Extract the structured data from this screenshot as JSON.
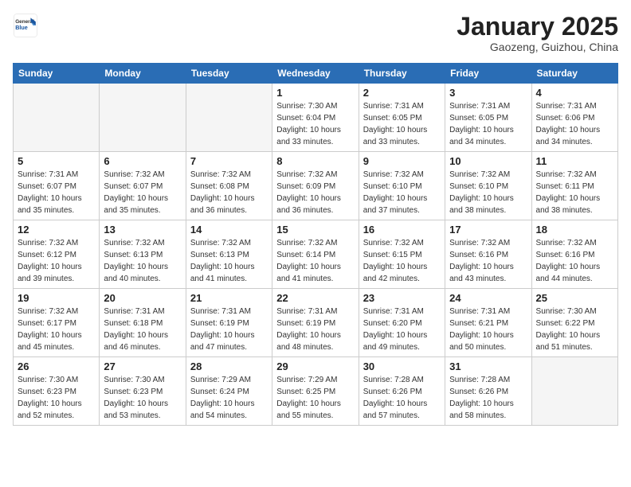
{
  "header": {
    "logo_general": "General",
    "logo_blue": "Blue",
    "month": "January 2025",
    "location": "Gaozeng, Guizhou, China"
  },
  "days_of_week": [
    "Sunday",
    "Monday",
    "Tuesday",
    "Wednesday",
    "Thursday",
    "Friday",
    "Saturday"
  ],
  "weeks": [
    [
      {
        "day": "",
        "info": ""
      },
      {
        "day": "",
        "info": ""
      },
      {
        "day": "",
        "info": ""
      },
      {
        "day": "1",
        "info": "Sunrise: 7:30 AM\nSunset: 6:04 PM\nDaylight: 10 hours\nand 33 minutes."
      },
      {
        "day": "2",
        "info": "Sunrise: 7:31 AM\nSunset: 6:05 PM\nDaylight: 10 hours\nand 33 minutes."
      },
      {
        "day": "3",
        "info": "Sunrise: 7:31 AM\nSunset: 6:05 PM\nDaylight: 10 hours\nand 34 minutes."
      },
      {
        "day": "4",
        "info": "Sunrise: 7:31 AM\nSunset: 6:06 PM\nDaylight: 10 hours\nand 34 minutes."
      }
    ],
    [
      {
        "day": "5",
        "info": "Sunrise: 7:31 AM\nSunset: 6:07 PM\nDaylight: 10 hours\nand 35 minutes."
      },
      {
        "day": "6",
        "info": "Sunrise: 7:32 AM\nSunset: 6:07 PM\nDaylight: 10 hours\nand 35 minutes."
      },
      {
        "day": "7",
        "info": "Sunrise: 7:32 AM\nSunset: 6:08 PM\nDaylight: 10 hours\nand 36 minutes."
      },
      {
        "day": "8",
        "info": "Sunrise: 7:32 AM\nSunset: 6:09 PM\nDaylight: 10 hours\nand 36 minutes."
      },
      {
        "day": "9",
        "info": "Sunrise: 7:32 AM\nSunset: 6:10 PM\nDaylight: 10 hours\nand 37 minutes."
      },
      {
        "day": "10",
        "info": "Sunrise: 7:32 AM\nSunset: 6:10 PM\nDaylight: 10 hours\nand 38 minutes."
      },
      {
        "day": "11",
        "info": "Sunrise: 7:32 AM\nSunset: 6:11 PM\nDaylight: 10 hours\nand 38 minutes."
      }
    ],
    [
      {
        "day": "12",
        "info": "Sunrise: 7:32 AM\nSunset: 6:12 PM\nDaylight: 10 hours\nand 39 minutes."
      },
      {
        "day": "13",
        "info": "Sunrise: 7:32 AM\nSunset: 6:13 PM\nDaylight: 10 hours\nand 40 minutes."
      },
      {
        "day": "14",
        "info": "Sunrise: 7:32 AM\nSunset: 6:13 PM\nDaylight: 10 hours\nand 41 minutes."
      },
      {
        "day": "15",
        "info": "Sunrise: 7:32 AM\nSunset: 6:14 PM\nDaylight: 10 hours\nand 41 minutes."
      },
      {
        "day": "16",
        "info": "Sunrise: 7:32 AM\nSunset: 6:15 PM\nDaylight: 10 hours\nand 42 minutes."
      },
      {
        "day": "17",
        "info": "Sunrise: 7:32 AM\nSunset: 6:16 PM\nDaylight: 10 hours\nand 43 minutes."
      },
      {
        "day": "18",
        "info": "Sunrise: 7:32 AM\nSunset: 6:16 PM\nDaylight: 10 hours\nand 44 minutes."
      }
    ],
    [
      {
        "day": "19",
        "info": "Sunrise: 7:32 AM\nSunset: 6:17 PM\nDaylight: 10 hours\nand 45 minutes."
      },
      {
        "day": "20",
        "info": "Sunrise: 7:31 AM\nSunset: 6:18 PM\nDaylight: 10 hours\nand 46 minutes."
      },
      {
        "day": "21",
        "info": "Sunrise: 7:31 AM\nSunset: 6:19 PM\nDaylight: 10 hours\nand 47 minutes."
      },
      {
        "day": "22",
        "info": "Sunrise: 7:31 AM\nSunset: 6:19 PM\nDaylight: 10 hours\nand 48 minutes."
      },
      {
        "day": "23",
        "info": "Sunrise: 7:31 AM\nSunset: 6:20 PM\nDaylight: 10 hours\nand 49 minutes."
      },
      {
        "day": "24",
        "info": "Sunrise: 7:31 AM\nSunset: 6:21 PM\nDaylight: 10 hours\nand 50 minutes."
      },
      {
        "day": "25",
        "info": "Sunrise: 7:30 AM\nSunset: 6:22 PM\nDaylight: 10 hours\nand 51 minutes."
      }
    ],
    [
      {
        "day": "26",
        "info": "Sunrise: 7:30 AM\nSunset: 6:23 PM\nDaylight: 10 hours\nand 52 minutes."
      },
      {
        "day": "27",
        "info": "Sunrise: 7:30 AM\nSunset: 6:23 PM\nDaylight: 10 hours\nand 53 minutes."
      },
      {
        "day": "28",
        "info": "Sunrise: 7:29 AM\nSunset: 6:24 PM\nDaylight: 10 hours\nand 54 minutes."
      },
      {
        "day": "29",
        "info": "Sunrise: 7:29 AM\nSunset: 6:25 PM\nDaylight: 10 hours\nand 55 minutes."
      },
      {
        "day": "30",
        "info": "Sunrise: 7:28 AM\nSunset: 6:26 PM\nDaylight: 10 hours\nand 57 minutes."
      },
      {
        "day": "31",
        "info": "Sunrise: 7:28 AM\nSunset: 6:26 PM\nDaylight: 10 hours\nand 58 minutes."
      },
      {
        "day": "",
        "info": ""
      }
    ]
  ]
}
